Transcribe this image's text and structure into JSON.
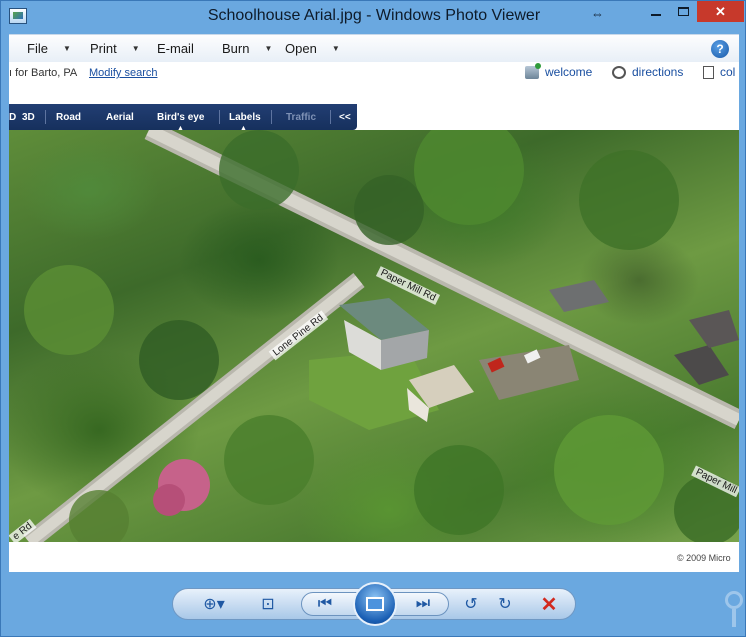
{
  "window": {
    "title": "Schoolhouse Arial.jpg - Windows Photo Viewer",
    "resize_glyph": "⇔",
    "close_glyph": "✕"
  },
  "menu": {
    "items": [
      {
        "label": "File",
        "has_dropdown": true
      },
      {
        "label": "Print",
        "has_dropdown": true
      },
      {
        "label": "E-mail",
        "has_dropdown": false
      },
      {
        "label": "Burn",
        "has_dropdown": true
      },
      {
        "label": "Open",
        "has_dropdown": true
      }
    ],
    "help_glyph": "?"
  },
  "web_header": {
    "search_text": "ı for Barto, PA",
    "modify_search": "Modify search",
    "welcome": "welcome",
    "directions": "directions",
    "collections_partial": "col"
  },
  "map_toolbar": {
    "items": [
      {
        "label": "D",
        "state": "normal"
      },
      {
        "label": "3D",
        "state": "normal"
      },
      {
        "label": "Road",
        "state": "normal"
      },
      {
        "label": "Aerial",
        "state": "normal"
      },
      {
        "label": "Bird's eye",
        "state": "selected"
      },
      {
        "label": "Labels",
        "state": "selected"
      },
      {
        "label": "Traffic",
        "state": "disabled"
      },
      {
        "label": "<<",
        "state": "normal"
      }
    ]
  },
  "photo": {
    "roads": [
      {
        "name": "Paper Mill Rd"
      },
      {
        "name": "Lone Pine Rd"
      },
      {
        "name": "Paper Mill"
      },
      {
        "name": "e Rd"
      }
    ],
    "copyright": "© 2009 Micro"
  },
  "controls": {
    "zoom": "⊕▾",
    "actual_size": "⊡",
    "previous": "⏮",
    "next": "⏭",
    "rotate_ccw": "↺",
    "rotate_cw": "↻",
    "delete": "✕"
  },
  "colors": {
    "window_frame": "#6aa8e0",
    "close_button": "#c7392b",
    "map_toolbar_bg": "#1c3768",
    "link": "#1a4fa0"
  }
}
